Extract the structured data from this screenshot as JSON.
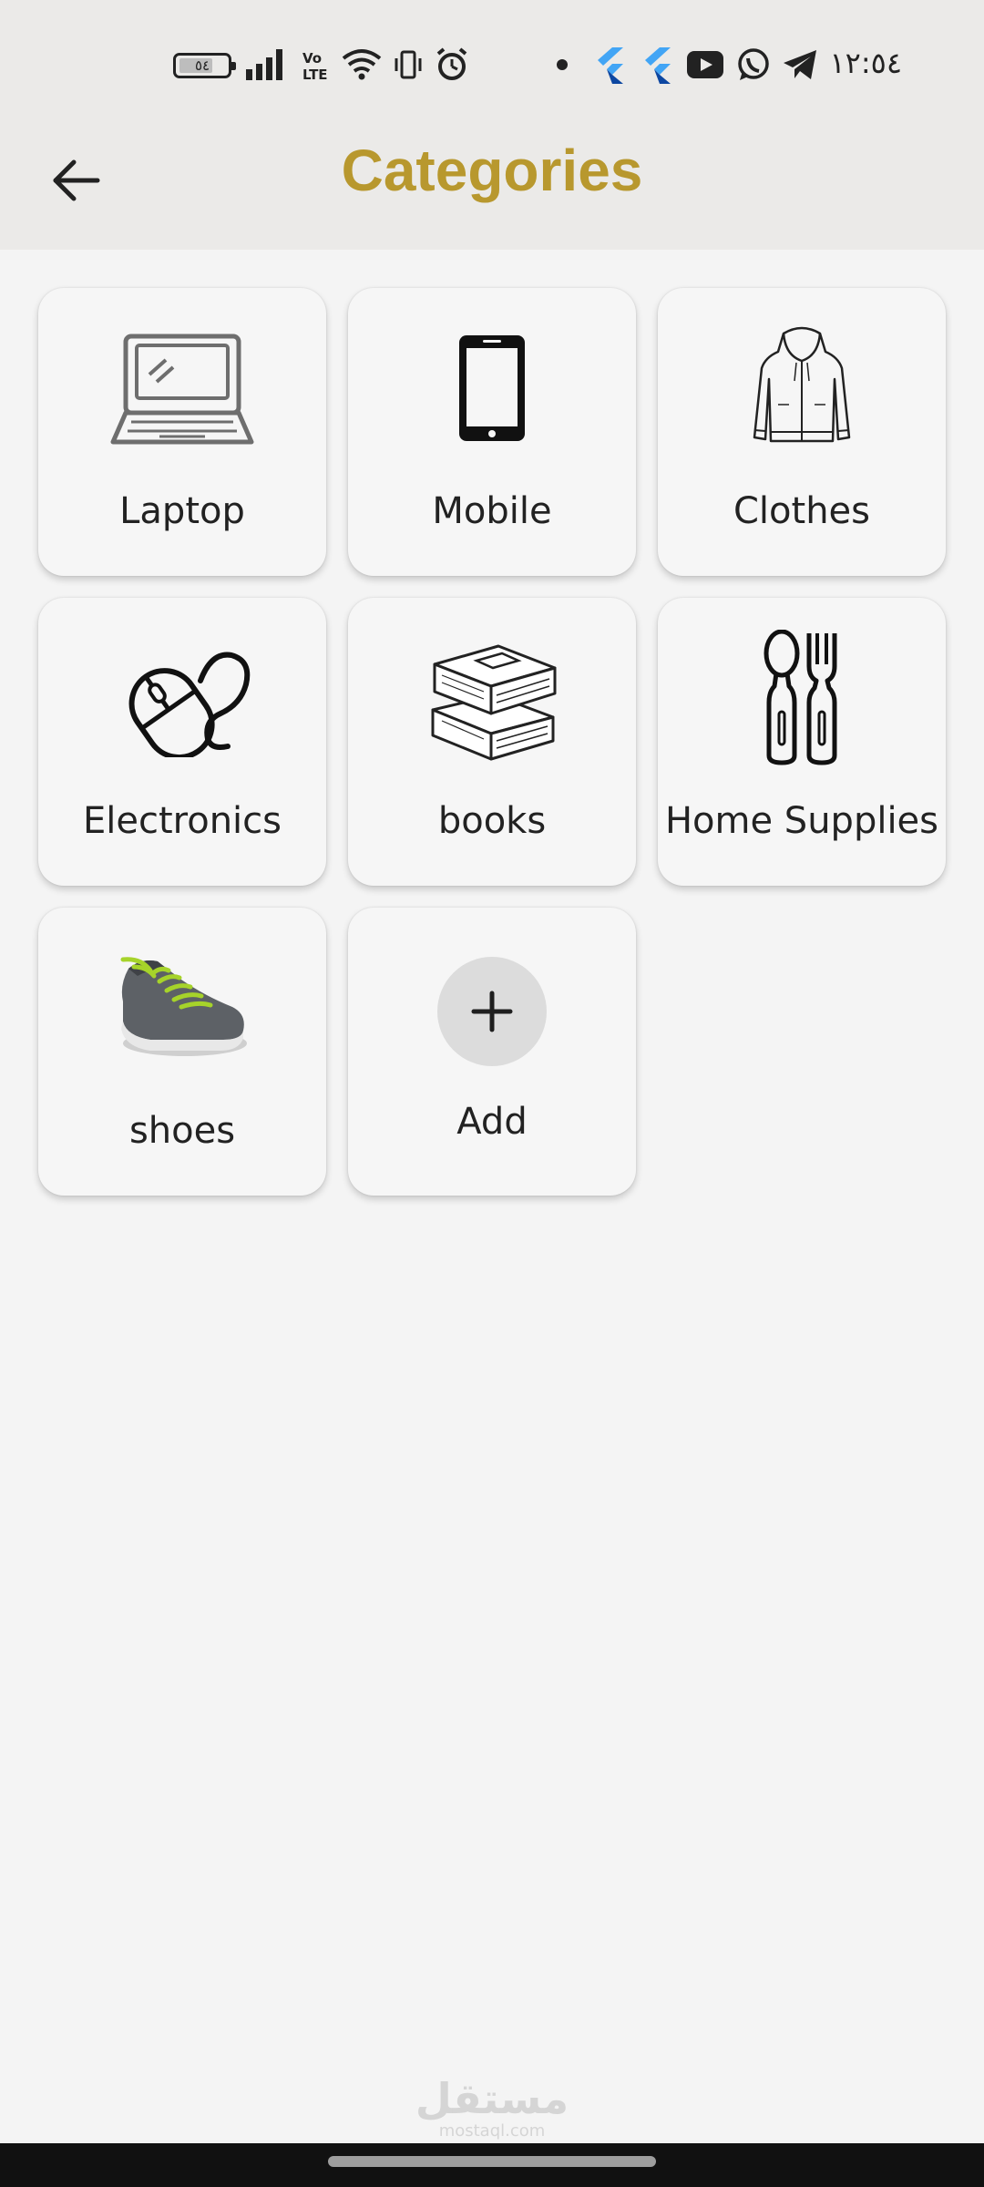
{
  "status_bar": {
    "battery_level": "٥٤",
    "time": "١٢:٥٤",
    "icons": [
      "battery-icon",
      "signal-icon",
      "volte-icon",
      "wifi-icon",
      "vibrate-icon",
      "alarm-icon",
      "dot-icon",
      "flutter-icon",
      "flutter-icon",
      "youtube-icon",
      "whatsapp-icon",
      "telegram-icon"
    ]
  },
  "app_bar": {
    "back_icon": "arrow-left-icon",
    "title": "Categories",
    "title_color": "#b8982e"
  },
  "categories": [
    {
      "label": "Laptop",
      "icon": "laptop-icon"
    },
    {
      "label": "Mobile",
      "icon": "mobile-icon"
    },
    {
      "label": "Clothes",
      "icon": "hoodie-icon"
    },
    {
      "label": "Electronics",
      "icon": "mouse-icon"
    },
    {
      "label": "books",
      "icon": "books-icon"
    },
    {
      "label": "Home Supplies",
      "icon": "utensils-icon"
    },
    {
      "label": "shoes",
      "icon": "shoe-icon"
    }
  ],
  "add_card": {
    "label": "Add",
    "icon": "plus-icon"
  },
  "watermark": {
    "text": "مستقل",
    "sub": "mostaql.com"
  }
}
